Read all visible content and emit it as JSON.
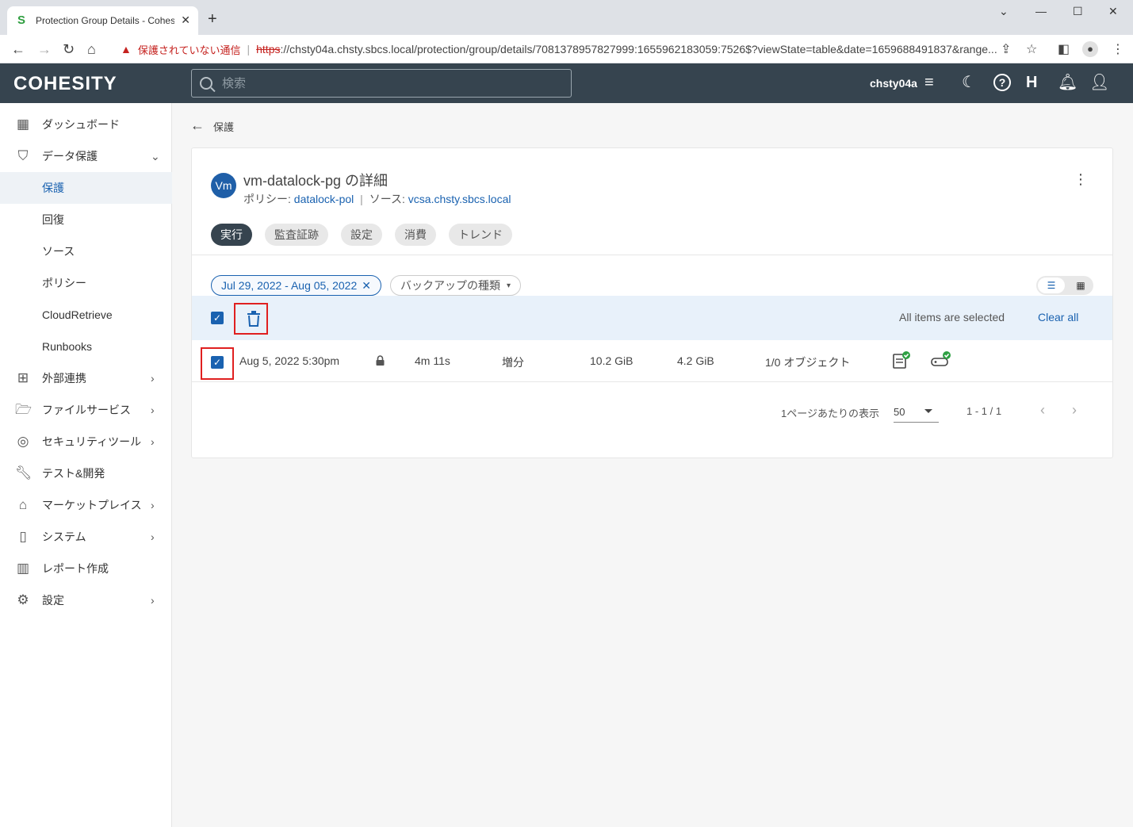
{
  "browser": {
    "tab_title": "Protection Group Details - Cohesity",
    "insecure_label": "保護されていない通信",
    "url_scheme": "https",
    "url_rest": "://chsty04a.chsty.sbcs.local/protection/group/details/7081378957827999:1655962183059:7526$?viewState=table&date=1659688491837&range..."
  },
  "header": {
    "logo": "COHESITY",
    "search_placeholder": "検索",
    "user": "chsty04a"
  },
  "sidebar": {
    "items": [
      {
        "label": "ダッシュボード",
        "icon": "dashboard-icon"
      },
      {
        "label": "データ保護",
        "icon": "shield-icon"
      },
      {
        "label": "保護"
      },
      {
        "label": "回復"
      },
      {
        "label": "ソース"
      },
      {
        "label": "ポリシー"
      },
      {
        "label": "CloudRetrieve"
      },
      {
        "label": "Runbooks"
      },
      {
        "label": "外部連携",
        "icon": "hierarchy-icon"
      },
      {
        "label": "ファイルサービス",
        "icon": "folder-icon"
      },
      {
        "label": "セキュリティツール",
        "icon": "fingerprint-icon"
      },
      {
        "label": "テスト&開発",
        "icon": "wrench-icon"
      },
      {
        "label": "マーケットプレイス",
        "icon": "store-icon"
      },
      {
        "label": "システム",
        "icon": "system-icon"
      },
      {
        "label": "レポート作成",
        "icon": "report-icon"
      },
      {
        "label": "設定",
        "icon": "gear-icon"
      }
    ]
  },
  "breadcrumb": {
    "label": "保護"
  },
  "group": {
    "avatar": "Vm",
    "title": "vm-datalock-pg の詳細",
    "policy_label": "ポリシー:",
    "policy": "datalock-pol",
    "source_label": "ソース:",
    "source": "vcsa.chsty.sbcs.local"
  },
  "tabs": [
    {
      "label": "実行",
      "active": true
    },
    {
      "label": "監査証跡"
    },
    {
      "label": "設定"
    },
    {
      "label": "消費"
    },
    {
      "label": "トレンド"
    }
  ],
  "filters": {
    "date_range": "Jul 29, 2022 - Aug 05, 2022",
    "backup_type": "バックアップの種類"
  },
  "selection": {
    "status": "All items are selected",
    "clear_all": "Clear all"
  },
  "runs": [
    {
      "start_time": "Aug 5, 2022 5:30pm",
      "duration": "4m 11s",
      "type": "増分",
      "data_read": "10.2 GiB",
      "data_written": "4.2 GiB",
      "objects": "1/0 オブジェクト"
    }
  ],
  "pager": {
    "per_page_label": "1ページあたりの表示",
    "per_page": "50",
    "range": "1 - 1 / 1"
  },
  "colors": {
    "appbar": "#36444f",
    "accent": "#1a62b0",
    "highlight": "#e02020",
    "success": "#2ea043"
  }
}
